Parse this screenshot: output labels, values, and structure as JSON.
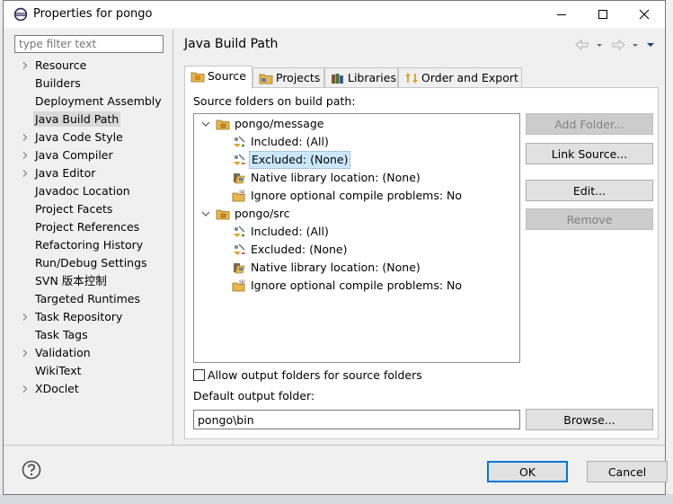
{
  "window": {
    "title": "Properties for pongo"
  },
  "filter": {
    "placeholder": "type filter text"
  },
  "nav": {
    "items": [
      {
        "label": "Resource",
        "expandable": true
      },
      {
        "label": "Builders",
        "expandable": false
      },
      {
        "label": "Deployment Assembly",
        "expandable": false
      },
      {
        "label": "Java Build Path",
        "expandable": false,
        "selected": true
      },
      {
        "label": "Java Code Style",
        "expandable": true
      },
      {
        "label": "Java Compiler",
        "expandable": true
      },
      {
        "label": "Java Editor",
        "expandable": true
      },
      {
        "label": "Javadoc Location",
        "expandable": false
      },
      {
        "label": "Project Facets",
        "expandable": false
      },
      {
        "label": "Project References",
        "expandable": false
      },
      {
        "label": "Refactoring History",
        "expandable": false
      },
      {
        "label": "Run/Debug Settings",
        "expandable": false
      },
      {
        "label": "SVN 版本控制",
        "expandable": false
      },
      {
        "label": "Targeted Runtimes",
        "expandable": false
      },
      {
        "label": "Task Repository",
        "expandable": true
      },
      {
        "label": "Task Tags",
        "expandable": false
      },
      {
        "label": "Validation",
        "expandable": true
      },
      {
        "label": "WikiText",
        "expandable": false
      },
      {
        "label": "XDoclet",
        "expandable": true
      }
    ]
  },
  "page": {
    "title": "Java Build Path"
  },
  "tabs": [
    {
      "label": "Source",
      "icon": "source-folder-icon",
      "active": true
    },
    {
      "label": "Projects",
      "icon": "projects-icon",
      "active": false
    },
    {
      "label": "Libraries",
      "icon": "libraries-icon",
      "active": false
    },
    {
      "label": "Order and Export",
      "icon": "order-export-icon",
      "active": false
    }
  ],
  "source": {
    "folders_label": "Source folders on build path:",
    "tree": [
      {
        "label": "pongo/message",
        "level": 0,
        "icon": "package-folder-icon"
      },
      {
        "label": "Included: (All)",
        "level": 1,
        "icon": "inclusion-filter-icon"
      },
      {
        "label": "Excluded: (None)",
        "level": 1,
        "icon": "exclusion-filter-icon",
        "selected": true
      },
      {
        "label": "Native library location: (None)",
        "level": 1,
        "icon": "native-library-icon"
      },
      {
        "label": "Ignore optional compile problems: No",
        "level": 1,
        "icon": "ignore-problems-icon"
      },
      {
        "label": "pongo/src",
        "level": 0,
        "icon": "package-folder-icon"
      },
      {
        "label": "Included: (All)",
        "level": 1,
        "icon": "inclusion-filter-icon"
      },
      {
        "label": "Excluded: (None)",
        "level": 1,
        "icon": "exclusion-filter-icon"
      },
      {
        "label": "Native library location: (None)",
        "level": 1,
        "icon": "native-library-icon"
      },
      {
        "label": "Ignore optional compile problems: No",
        "level": 1,
        "icon": "ignore-problems-icon"
      }
    ],
    "buttons": {
      "add_folder": "Add Folder...",
      "link_source": "Link Source...",
      "edit": "Edit...",
      "remove": "Remove"
    },
    "allow_output_label": "Allow output folders for source folders",
    "allow_output_checked": false,
    "default_output_label": "Default output folder:",
    "default_output_value": "pongo\\bin",
    "browse": "Browse..."
  },
  "footer": {
    "ok": "OK",
    "cancel": "Cancel"
  },
  "colors": {
    "accent": "#0078d7",
    "selection": "#cce8ff",
    "folder": "#e8b64a"
  }
}
